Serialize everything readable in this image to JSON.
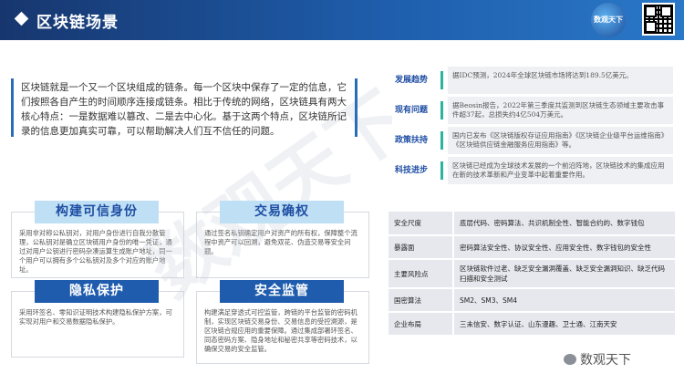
{
  "header": {
    "title": "区块链场景",
    "logo_text": "数观天下"
  },
  "intro": "区块链就是一个又一个区块组成的链条。每一个区块中保存了一定的信息，它们按照各自产生的时间顺序连接成链条。相比于传统的网络，区块链具有两大核心特点：一是数据难以篡改、二是去中心化。基于这两个特点，区块链所记录的信息更加真实可靠，可以帮助解决人们互不信任的问题。",
  "trend_rows": [
    {
      "label": "发展趋势",
      "text": "据IDC预测，2024年全球区块链市场将达到189.5亿美元。"
    },
    {
      "label": "现有问题",
      "text": "据Beosin报告，2022年第三季度共监测到区块链生态领域主要攻击事件超37起，总损失约4亿504万美元。"
    },
    {
      "label": "政策扶持",
      "text": "国内已发布《区块链版权存证应用指南》《区块链企业级平台运维指南》《区块链供应链金融服务应用指南》等。"
    },
    {
      "label": "科技进步",
      "text": "区块链已经成为全球技术发展的一个前沿阵地，区块链技术的集成应用在新的技术革新和产业变革中起着重要作用。"
    }
  ],
  "features": [
    {
      "title": "构建可信身份",
      "text": "采用非对称公私钥对，对用户身份进行自我分散管理，公私钥对是确立区块链用户身份的唯一凭证，通过对用户公钥进行密码杂凑运算生成账户地址，同一个用户可以拥有多个公私钥对及多个对应的账户地址。"
    },
    {
      "title": "交易确权",
      "text": "通过签名私钥确定用户对资产的所有权，保障整个流程中资产可以回溯，避免双花、伪造交易等安全问题。"
    },
    {
      "title": "隐私保护",
      "text": "采用环签名、零知识证明技术构建隐私保护方案，可实现对用户和交易数据隐私保护。"
    },
    {
      "title": "安全监管",
      "text": "构建满足穿透式可控监管，跨链的平台监管的密码机制，实现区块链交易身份、交易信息的受控溯源，是区块链合规应用的重要保障。通过集成部署环签名、同态密码方案、隐身地址和秘密共享等密码技术，以确保交易的安全监管。"
    }
  ],
  "table": [
    {
      "key": "安全尺度",
      "value": "底层代码、密码算法、共识机制全性、智能合约的、数字钱包"
    },
    {
      "key": "暴露面",
      "value": "密码算法安全性、协议安全性、应用安全性、数字钱包的安全性"
    },
    {
      "key": "主要风险点",
      "value": "区块链软件过老、缺乏安全漏洞覆盖、缺乏安全漏洞知识、缺乏代码扫描和安全测试"
    },
    {
      "key": "国密算法",
      "value": "SM2、SM3、SM4"
    },
    {
      "key": "企业布局",
      "value": "三未信安、数字认证、山东漫趣、卫士通、江南天安"
    }
  ],
  "watermark": "数观天下",
  "wechat_label": "数观天下"
}
